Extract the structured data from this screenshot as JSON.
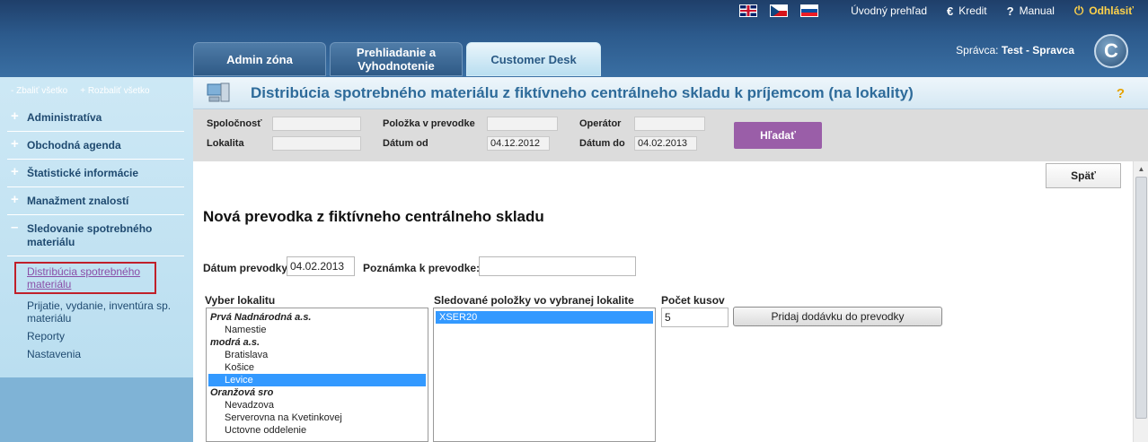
{
  "header": {
    "links": {
      "overview": "Úvodný prehľad",
      "credit": "Kredit",
      "manual": "Manual",
      "logout": "Odhlásiť"
    },
    "tabs": [
      "Admin zóna",
      "Prehliadanie a Vyhodnotenie",
      "Customer Desk"
    ],
    "active_tab": "Customer Desk",
    "admin_label": "Správca:",
    "admin_name": "Test - Spravca",
    "logo_letter": "C"
  },
  "sidebar": {
    "collapse_all": "- Zbaliť všetko",
    "expand_all": "+ Rozbaliť všetko",
    "items": [
      {
        "label": "Administratíva"
      },
      {
        "label": "Obchodná agenda"
      },
      {
        "label": "Štatistické informácie"
      },
      {
        "label": "Manažment znalostí"
      },
      {
        "label": "Sledovanie spotrebného materiálu"
      }
    ],
    "subitems": [
      "Distribúcia spotrebného materiálu",
      "Prijatie, vydanie, inventúra sp. materiálu",
      "Reporty",
      "Nastavenia"
    ]
  },
  "page": {
    "title": "Distribúcia spotrebného materiálu z fiktívneho centrálneho skladu k príjemcom (na lokality)",
    "help": "?"
  },
  "filter": {
    "company_label": "Spoločnosť",
    "location_label": "Lokalita",
    "item_label": "Položka v prevodke",
    "date_from_label": "Dátum od",
    "date_from": "04.12.2012",
    "operator_label": "Operátor",
    "date_to_label": "Dátum do",
    "date_to": "04.02.2013",
    "search_button": "Hľadať"
  },
  "form": {
    "back_button": "Späť",
    "section_title": "Nová prevodka z fiktívneho centrálneho skladu",
    "transfer_date_label": "Dátum prevodky:",
    "transfer_date": "04.02.2013",
    "note_label": "Poznámka k prevodke:",
    "note": "",
    "choose_location_label": "Vyber lokalitu",
    "tracked_items_label": "Sledované položky vo vybranej lokalite",
    "count_label": "Počet kusov",
    "count": "5",
    "add_button": "Pridaj dodávku do prevodky",
    "locations": [
      {
        "text": "Prvá Nadnárodná a.s.",
        "type": "group"
      },
      {
        "text": "Namestie",
        "type": "child"
      },
      {
        "text": "modrá a.s.",
        "type": "group"
      },
      {
        "text": "Bratislava",
        "type": "child"
      },
      {
        "text": "Košice",
        "type": "child"
      },
      {
        "text": "Levice",
        "type": "child",
        "selected": true
      },
      {
        "text": "Oranžová sro",
        "type": "group"
      },
      {
        "text": "Nevadzova",
        "type": "child"
      },
      {
        "text": "Serverovna na Kvetinkovej",
        "type": "child"
      },
      {
        "text": "Uctovne oddelenie",
        "type": "child"
      }
    ],
    "tracked_items": [
      {
        "text": "XSER20",
        "selected": true
      }
    ]
  },
  "colors": {
    "header_dark": "#1f3f6a",
    "sidebar_bg": "#cde8f5",
    "title_blue": "#2e6b9a",
    "search_purple": "#9a5ea8",
    "selection_blue": "#3399ff",
    "logout_yellow": "#ffd24a"
  }
}
